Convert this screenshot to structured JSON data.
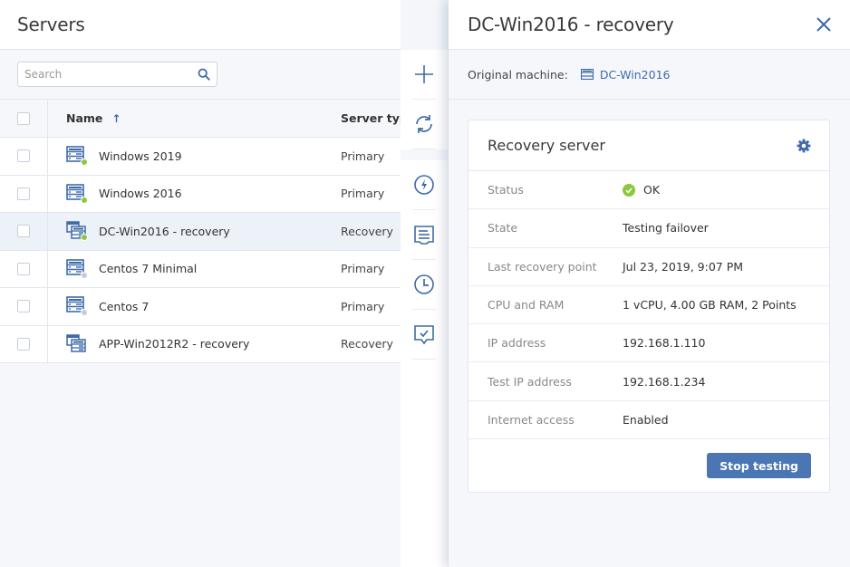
{
  "list": {
    "title": "Servers",
    "search_placeholder": "Search",
    "columns": {
      "name": "Name",
      "sort_indicator": "↑",
      "type": "Server type"
    },
    "rows": [
      {
        "name": "Windows 2019",
        "type": "Primary",
        "icon": "server-icon",
        "status_color": "#8dc63f",
        "selected": false
      },
      {
        "name": "Windows 2016",
        "type": "Primary",
        "icon": "server-icon",
        "status_color": "#8dc63f",
        "selected": false
      },
      {
        "name": "DC-Win2016 - recovery",
        "type": "Recovery",
        "icon": "recovery-server-icon",
        "status_color": "#8dc63f",
        "selected": true
      },
      {
        "name": "Centos 7 Minimal",
        "type": "Primary",
        "icon": "server-icon",
        "status_color": "#c8ccd2",
        "selected": false
      },
      {
        "name": "Centos 7",
        "type": "Primary",
        "icon": "server-icon",
        "status_color": "#c8ccd2",
        "selected": false
      },
      {
        "name": "APP-Win2012R2 - recovery",
        "type": "Recovery",
        "icon": "recovery-server-icon",
        "status_color": null,
        "selected": false
      }
    ]
  },
  "toolbar": {
    "items": [
      {
        "name": "add",
        "icon": "plus-icon"
      },
      {
        "name": "refresh",
        "icon": "refresh-icon"
      },
      {
        "name": "failover",
        "icon": "lightning-icon"
      },
      {
        "name": "activities",
        "icon": "log-icon"
      },
      {
        "name": "history",
        "icon": "clock-icon"
      },
      {
        "name": "test",
        "icon": "monitor-check-icon"
      }
    ]
  },
  "details": {
    "title": "DC-Win2016 - recovery",
    "original_machine_label": "Original machine:",
    "original_machine_value": "DC-Win2016",
    "card": {
      "title": "Recovery server",
      "properties": [
        {
          "key": "Status",
          "value": "OK",
          "status": "ok"
        },
        {
          "key": "State",
          "value": "Testing failover"
        },
        {
          "key": "Last recovery point",
          "value": "Jul 23, 2019, 9:07 PM"
        },
        {
          "key": "CPU and RAM",
          "value": "1 vCPU, 4.00 GB RAM, 2 Points"
        },
        {
          "key": "IP address",
          "value": "192.168.1.110"
        },
        {
          "key": "Test IP address",
          "value": "192.168.1.234"
        },
        {
          "key": "Internet access",
          "value": "Enabled"
        }
      ],
      "action_label": "Stop testing"
    }
  },
  "colors": {
    "accent": "#4a76b4",
    "icon": "#3e6aa8",
    "ok": "#8dc63f"
  }
}
